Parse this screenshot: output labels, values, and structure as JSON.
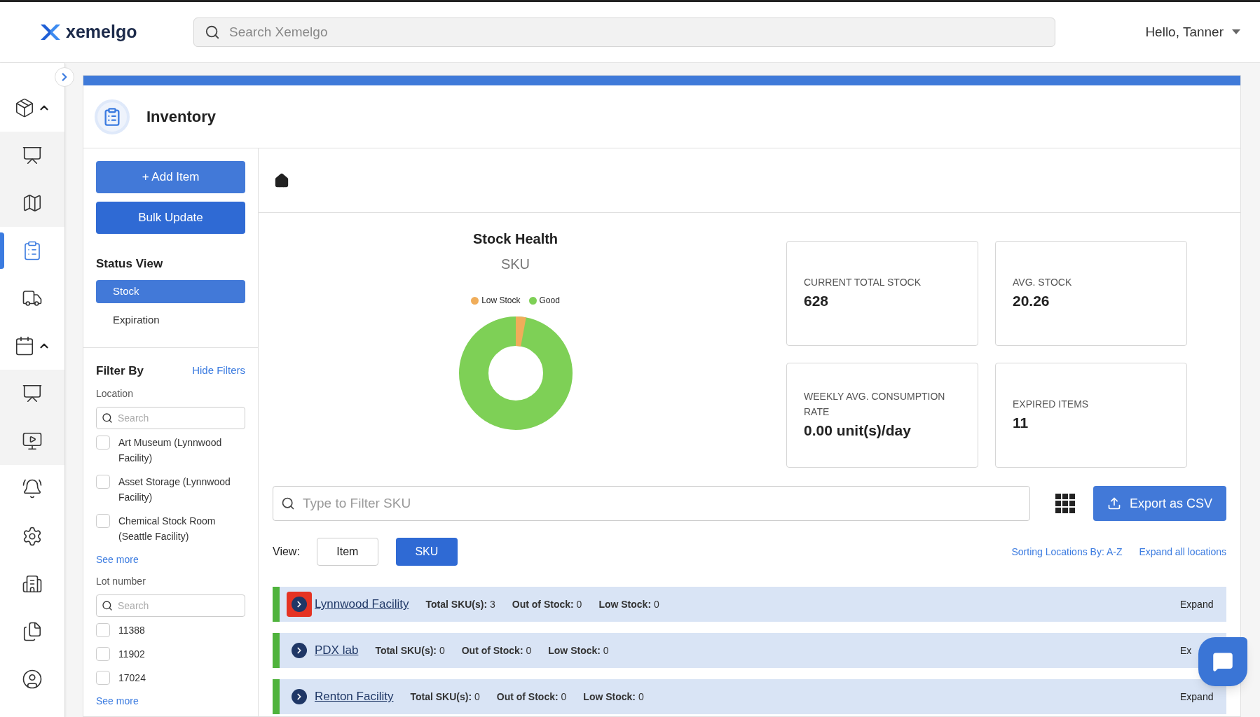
{
  "header": {
    "logo": "xemelgo",
    "search_placeholder": "Search Xemelgo",
    "greeting": "Hello, Tanner"
  },
  "nav": [
    {
      "expanded": true,
      "selected": false,
      "children": [
        {
          "selected": false
        },
        {
          "selected": false
        }
      ]
    },
    {
      "selected": true
    },
    {
      "selected": false
    },
    {
      "expanded": true,
      "selected": false,
      "children": [
        {
          "selected": false
        },
        {
          "selected": false
        }
      ]
    },
    {
      "selected": false
    },
    {
      "selected": false
    },
    {
      "selected": false
    },
    {
      "selected": false
    },
    {
      "selected": false
    }
  ],
  "page": {
    "title": "Inventory"
  },
  "actions": [
    {
      "label": "+ Add Item",
      "kind": "primary"
    },
    {
      "label": "Bulk Update",
      "kind": "strong"
    }
  ],
  "status_view": {
    "title": "Status View",
    "options": [
      {
        "label": "Stock",
        "selected": true
      },
      {
        "label": "Expiration",
        "selected": false
      }
    ]
  },
  "filters": {
    "title": "Filter By",
    "hide_link": "Hide Filters",
    "groups": [
      {
        "label": "Location",
        "placeholder": "Search",
        "see_more": "See more",
        "options": [
          {
            "label": "Art Museum (Lynnwood Facility)",
            "checked": false
          },
          {
            "label": "Asset Storage (Lynnwood Facility)",
            "checked": false
          },
          {
            "label": "Chemical Stock Room (Seattle Facility)",
            "checked": false
          }
        ]
      },
      {
        "label": "Lot number",
        "placeholder": "Search",
        "see_more": "See more",
        "options": [
          {
            "label": "11388",
            "checked": false
          },
          {
            "label": "11902",
            "checked": false
          },
          {
            "label": "17024",
            "checked": false
          }
        ]
      }
    ]
  },
  "chart": {
    "title": "Stock Health",
    "subtitle": "SKU",
    "legend": [
      {
        "label": "Low Stock",
        "color": "#f0ad5a"
      },
      {
        "label": "Good",
        "color": "#7ed056"
      }
    ]
  },
  "stats": [
    {
      "label": "CURRENT TOTAL STOCK",
      "value": "628"
    },
    {
      "label": "AVG. STOCK",
      "value": "20.26"
    },
    {
      "label": "WEEKLY AVG. CONSUMPTION RATE",
      "value": "0.00 unit(s)/day"
    },
    {
      "label": "EXPIRED ITEMS",
      "value": "11"
    }
  ],
  "sku_filter": {
    "placeholder": "Type to Filter SKU"
  },
  "export_button": "Export as CSV",
  "view": {
    "label": "View:",
    "options": [
      {
        "label": "Item",
        "selected": false
      },
      {
        "label": "SKU",
        "selected": true
      }
    ]
  },
  "sorting_link": "Sorting Locations By: A-Z",
  "expand_all_link": "Expand all locations",
  "locations": [
    {
      "name": "Lynnwood Facility",
      "highlighted": true,
      "action": "Expand",
      "stats": [
        {
          "label": "Total SKU(s):",
          "value": "3"
        },
        {
          "label": "Out of Stock:",
          "value": "0"
        },
        {
          "label": "Low Stock:",
          "value": "0"
        }
      ]
    },
    {
      "name": "PDX lab",
      "highlighted": false,
      "action": "Ex",
      "stats": [
        {
          "label": "Total SKU(s):",
          "value": "0"
        },
        {
          "label": "Out of Stock:",
          "value": "0"
        },
        {
          "label": "Low Stock:",
          "value": "0"
        }
      ]
    },
    {
      "name": "Renton Facility",
      "highlighted": false,
      "action": "Expand",
      "stats": [
        {
          "label": "Total SKU(s):",
          "value": "0"
        },
        {
          "label": "Out of Stock:",
          "value": "0"
        },
        {
          "label": "Low Stock:",
          "value": "0"
        }
      ]
    }
  ]
}
